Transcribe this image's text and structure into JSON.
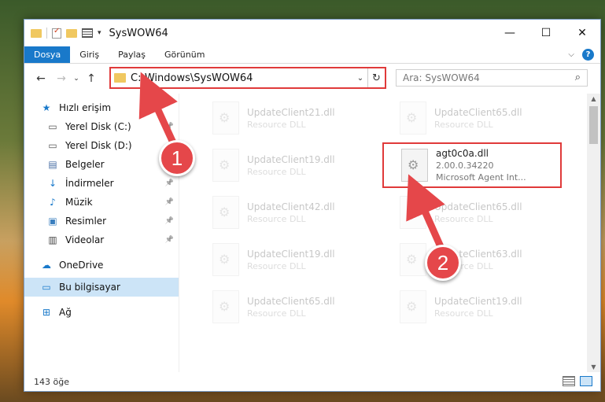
{
  "window": {
    "title": "SysWOW64",
    "controls": {
      "minimize": "—",
      "maximize": "☐",
      "close": "✕"
    }
  },
  "ribbon": {
    "tabs": [
      "Dosya",
      "Giriş",
      "Paylaş",
      "Görünüm"
    ],
    "active_tab": "Dosya",
    "help": "?"
  },
  "address": {
    "path": "C:\\Windows\\SysWOW64",
    "search_placeholder": "Ara: SysWOW64"
  },
  "sidebar": {
    "items": [
      {
        "label": "Hızlı erişim",
        "icon": "star-icon"
      },
      {
        "label": "Yerel Disk (C:)",
        "icon": "drive-icon",
        "pinned": true
      },
      {
        "label": "Yerel Disk (D:)",
        "icon": "drive-icon"
      },
      {
        "label": "Belgeler",
        "icon": "document-icon",
        "pinned": true
      },
      {
        "label": "İndirmeler",
        "icon": "download-icon",
        "pinned": true
      },
      {
        "label": "Müzik",
        "icon": "music-icon",
        "pinned": true
      },
      {
        "label": "Resimler",
        "icon": "pictures-icon",
        "pinned": true
      },
      {
        "label": "Videolar",
        "icon": "video-icon",
        "pinned": true
      },
      {
        "label": "OneDrive",
        "icon": "cloud-icon"
      },
      {
        "label": "Bu bilgisayar",
        "icon": "computer-icon",
        "selected": true
      },
      {
        "label": "Ağ",
        "icon": "network-icon"
      }
    ]
  },
  "files": [
    {
      "name": "UpdateClient21.dll",
      "meta": "Resource DLL"
    },
    {
      "name": "UpdateClient65.dll",
      "meta": "Resource DLL"
    },
    {
      "name": "UpdateClient19.dll",
      "meta": "Resource DLL"
    },
    {
      "name": "agt0c0a.dll",
      "meta": "2.00.0.34220",
      "meta2": "Microsoft Agent Int...",
      "highlighted": true
    },
    {
      "name": "UpdateClient42.dll",
      "meta": "Resource DLL"
    },
    {
      "name": "UpdateClient65.dll",
      "meta": "Resource DLL"
    },
    {
      "name": "UpdateClient19.dll",
      "meta": "Resource DLL"
    },
    {
      "name": "UpdateClient63.dll",
      "meta": "Resource DLL"
    },
    {
      "name": "UpdateClient65.dll",
      "meta": "Resource DLL"
    },
    {
      "name": "UpdateClient19.dll",
      "meta": "Resource DLL"
    }
  ],
  "status": {
    "count": "143 öğe"
  },
  "annotations": {
    "badge1": "1",
    "badge2": "2",
    "color": "#e5474a"
  }
}
